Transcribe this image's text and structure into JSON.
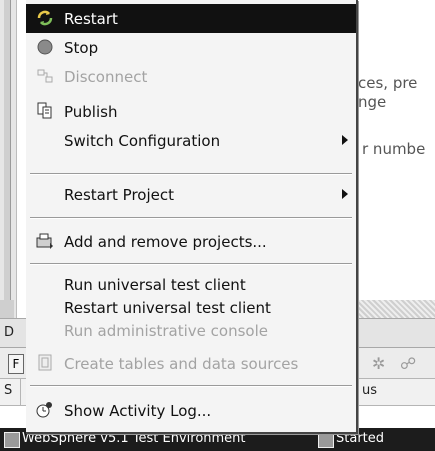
{
  "background": {
    "text_lines": [
      "ces, pre",
      "nge",
      "r numbe"
    ],
    "panel_label": "D",
    "column_left": "S",
    "column_right": "us",
    "left_button": "F",
    "server_row": {
      "name": "WebSphere v5.1 Test Environment",
      "status": "Started"
    }
  },
  "menu": {
    "items": [
      {
        "label": "Restart",
        "icon": "restart-icon",
        "state": "selected"
      },
      {
        "label": "Stop",
        "icon": "stop-icon",
        "state": "enabled"
      },
      {
        "label": "Disconnect",
        "icon": "disconnect-icon",
        "state": "disabled"
      },
      {
        "label": "Publish",
        "icon": "publish-icon",
        "state": "enabled"
      },
      {
        "label": "Switch Configuration",
        "icon": "",
        "state": "enabled",
        "submenu": true
      },
      {
        "label": "Restart Project",
        "icon": "",
        "state": "enabled",
        "submenu": true
      },
      {
        "label": "Add and remove projects...",
        "icon": "add-remove-projects-icon",
        "state": "enabled"
      },
      {
        "label": "Run universal test client",
        "icon": "",
        "state": "enabled"
      },
      {
        "label": "Restart universal test client",
        "icon": "",
        "state": "enabled"
      },
      {
        "label": "Run administrative console",
        "icon": "",
        "state": "disabled"
      },
      {
        "label": "Create tables and data sources",
        "icon": "database-icon",
        "state": "disabled"
      },
      {
        "label": "Show Activity Log...",
        "icon": "activity-log-icon",
        "state": "enabled"
      }
    ]
  },
  "colors": {
    "menu_bg": "#f4f4f4",
    "selected_bg": "#111111",
    "disabled_text": "#a3a3a3",
    "stop_red": "#c0392b"
  }
}
